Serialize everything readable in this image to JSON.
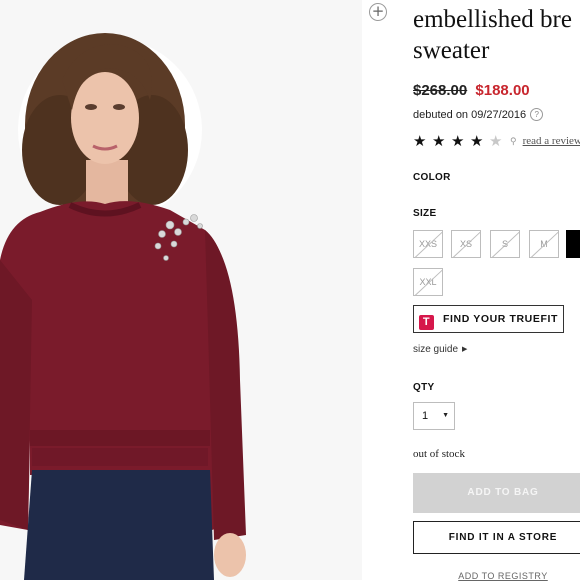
{
  "product": {
    "title": "embellished bre\nsweater",
    "price_original": "$268.00",
    "price_sale": "$188.00",
    "debut_text": "debuted on 09/27/2016",
    "debut_help_icon": "question-icon",
    "rating": {
      "filled": 4,
      "max": 5
    },
    "review_link": "read a review",
    "colors": {
      "price_sale": "#c8262e",
      "sweater": "#7a1b2b",
      "add_to_bag_disabled": "#d2d2d2",
      "truefit_brand": "#d6174b"
    }
  },
  "color_section": {
    "label": "COLOR"
  },
  "size_section": {
    "label": "SIZE",
    "sizes": [
      {
        "label": "XXS",
        "state": "unavailable"
      },
      {
        "label": "XS",
        "state": "unavailable"
      },
      {
        "label": "S",
        "state": "unavailable"
      },
      {
        "label": "M",
        "state": "unavailable"
      },
      {
        "label": "",
        "state": "selected"
      },
      {
        "label": "XXL",
        "state": "unavailable"
      }
    ],
    "truefit_label": "FIND YOUR TRUEFIT",
    "truefit_logo": "T",
    "size_guide": "size guide"
  },
  "qty_section": {
    "label": "QTY",
    "value": "1"
  },
  "stock_status": "out of stock",
  "actions": {
    "add_to_bag": "ADD TO BAG",
    "find_in_store": "FIND IT IN A STORE",
    "add_to_registry": "ADD TO REGISTRY"
  },
  "image": {
    "zoom_icon": "plus-circle-icon"
  }
}
